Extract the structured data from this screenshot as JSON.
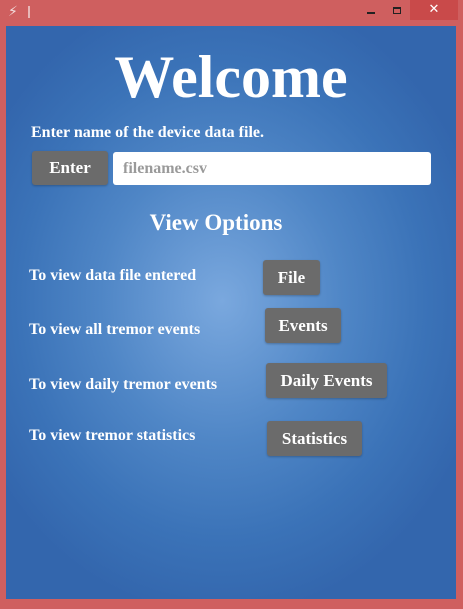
{
  "window": {
    "app_icon": "lightning-icon",
    "minimize_icon": "minimize-icon",
    "maximize_icon": "maximize-icon",
    "close_icon": "close-icon",
    "close_glyph": "✕",
    "titlebar_color": "#cf5f5f"
  },
  "main": {
    "heading": "Welcome",
    "file_prompt": "Enter name of the device data file.",
    "enter_label": "Enter",
    "filename_placeholder": "filename.csv",
    "filename_value": "",
    "view_options_heading": "View Options",
    "options": [
      {
        "label": "To view data file entered",
        "button": "File"
      },
      {
        "label": "To view all tremor events",
        "button": "Events"
      },
      {
        "label": "To view daily tremor events",
        "button": "Daily Events"
      },
      {
        "label": "To view tremor statistics",
        "button": "Statistics"
      }
    ],
    "background_color": "#4f86c6",
    "button_color": "#6b6b6b"
  }
}
